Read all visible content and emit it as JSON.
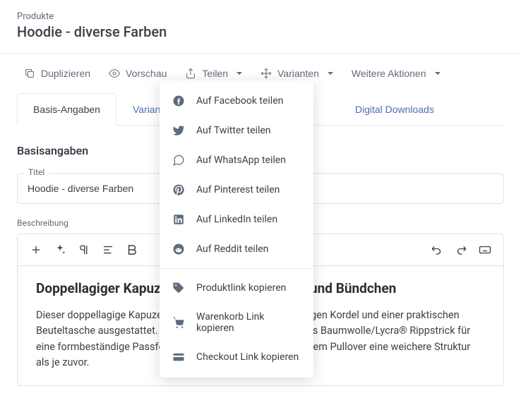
{
  "header": {
    "breadcrumb": "Produkte",
    "title": "Hoodie - diverse Farben"
  },
  "toolbar": {
    "duplicate": "Duplizieren",
    "preview": "Vorschau",
    "share": "Teilen",
    "variants": "Varianten",
    "more": "Weitere Aktionen"
  },
  "tabs": {
    "basic": "Basis-Angaben",
    "variants": "Varianten",
    "digital": "Digital Downloads"
  },
  "section_title": "Basisangaben",
  "title_field": {
    "label": "Titel",
    "value": "Hoodie - diverse Farben"
  },
  "desc_label": "Beschreibung",
  "editor_content": {
    "heading": "Doppellagiger Kapuzenpulli mit Beuteltasche und Bündchen",
    "paragraph": "Dieser doppellagige Kapuzensweater ist mit einer gleichfarbigen Kordel und einer praktischen Beuteltasche ausgestattet. Saum und Bündchen bestehen aus Baumwolle/Lycra® Rippstrick für eine formbeständige Passform. Das Belcoro® Garn verleiht dem Pullover eine weichere Struktur als je zuvor."
  },
  "share_menu": {
    "facebook": "Auf Facebook teilen",
    "twitter": "Auf Twitter teilen",
    "whatsapp": "Auf WhatsApp teilen",
    "pinterest": "Auf Pinterest teilen",
    "linkedin": "Auf LinkedIn teilen",
    "reddit": "Auf Reddit teilen",
    "productlink": "Produktlink kopieren",
    "cartlink": "Warenkorb Link kopieren",
    "checkoutlink": "Checkout Link kopieren"
  }
}
